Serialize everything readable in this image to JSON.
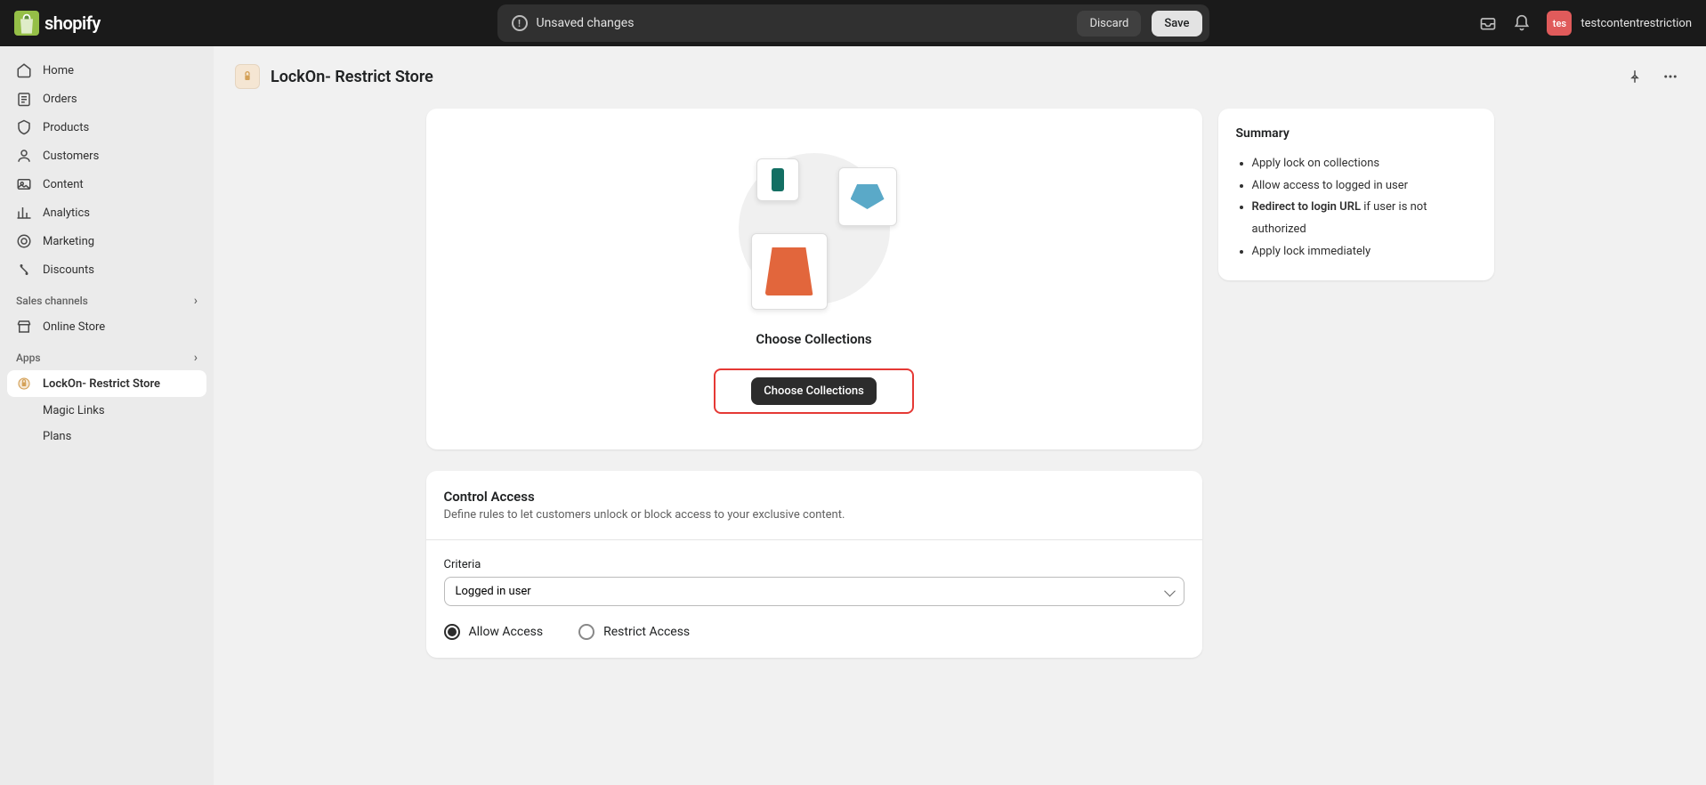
{
  "topbar": {
    "logo_text": "shopify",
    "unsaved_label": "Unsaved changes",
    "discard_label": "Discard",
    "save_label": "Save",
    "username": "testcontentrestriction",
    "avatar_initials": "tes"
  },
  "sidebar": {
    "items": [
      {
        "label": "Home",
        "icon": "home"
      },
      {
        "label": "Orders",
        "icon": "orders"
      },
      {
        "label": "Products",
        "icon": "products"
      },
      {
        "label": "Customers",
        "icon": "customers"
      },
      {
        "label": "Content",
        "icon": "content"
      },
      {
        "label": "Analytics",
        "icon": "analytics"
      },
      {
        "label": "Marketing",
        "icon": "marketing"
      },
      {
        "label": "Discounts",
        "icon": "discounts"
      }
    ],
    "sales_section": "Sales channels",
    "online_store": "Online Store",
    "apps_section": "Apps",
    "app_active": "LockOn- Restrict Store",
    "app_sub1": "Magic Links",
    "app_sub2": "Plans"
  },
  "page": {
    "title": "LockOn- Restrict Store"
  },
  "choose": {
    "heading": "Choose Collections",
    "button": "Choose Collections"
  },
  "control": {
    "title": "Control Access",
    "desc": "Define rules to let customers unlock or block access to your exclusive content.",
    "criteria_label": "Criteria",
    "criteria_value": "Logged in user",
    "radio_allow": "Allow Access",
    "radio_restrict": "Restrict Access"
  },
  "summary": {
    "title": "Summary",
    "item1": "Apply lock on collections",
    "item2": "Allow access to logged in user",
    "item3_bold": "Redirect to login URL",
    "item3_rest": " if user is not authorized",
    "item4": "Apply lock immediately"
  }
}
